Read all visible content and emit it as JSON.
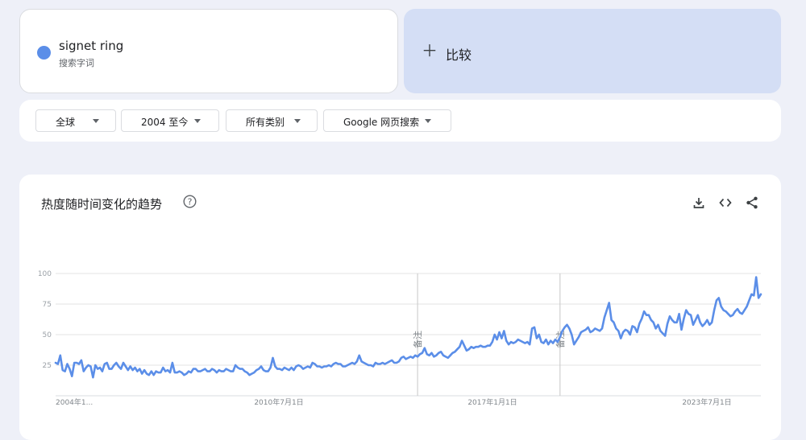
{
  "search_term": {
    "name": "signet ring",
    "type": "搜索字词",
    "color": "#5b8ee8"
  },
  "compare": {
    "label": "比较"
  },
  "filters": [
    {
      "label": "全球"
    },
    {
      "label": "2004 至今"
    },
    {
      "label": "所有类别"
    },
    {
      "label": "Google 网页搜索"
    }
  ],
  "chart": {
    "title": "热度随时间变化的趋势"
  },
  "chart_data": {
    "type": "line",
    "title": "热度随时间变化的趋势",
    "ylim": [
      0,
      100
    ],
    "y_ticks": [
      100,
      75,
      50,
      25
    ],
    "x_tick_labels": [
      "2004年1...",
      "2010年7月1日",
      "2017年1月1日",
      "2023年7月1日"
    ],
    "annotations": [
      {
        "label": "备注",
        "date": "2016-12"
      },
      {
        "label": "备注",
        "date": "2022-01"
      }
    ],
    "series": [
      {
        "color": "#5b8ee8",
        "start": "2004-01",
        "frequency": "monthly",
        "values": [
          27,
          26,
          33,
          21,
          20,
          26,
          22,
          16,
          27,
          27,
          26,
          29,
          20,
          23,
          25,
          24,
          15,
          25,
          22,
          23,
          20,
          26,
          27,
          22,
          22,
          25,
          27,
          24,
          22,
          27,
          24,
          21,
          24,
          21,
          23,
          20,
          22,
          18,
          21,
          18,
          17,
          20,
          17,
          20,
          19,
          19,
          23,
          20,
          21,
          19,
          27,
          19,
          19,
          20,
          19,
          17,
          18,
          20,
          19,
          22,
          22,
          20,
          20,
          21,
          22,
          20,
          20,
          22,
          21,
          19,
          21,
          20,
          20,
          22,
          21,
          20,
          20,
          25,
          23,
          22,
          22,
          20,
          19,
          17,
          18,
          19,
          21,
          22,
          24,
          21,
          20,
          20,
          23,
          31,
          24,
          22,
          22,
          21,
          23,
          22,
          21,
          23,
          21,
          24,
          25,
          24,
          22,
          23,
          24,
          23,
          27,
          26,
          24,
          24,
          23,
          24,
          24,
          25,
          24,
          26,
          27,
          26,
          26,
          24,
          24,
          25,
          26,
          27,
          26,
          28,
          33,
          28,
          27,
          26,
          25,
          25,
          24,
          27,
          26,
          26,
          27,
          26,
          27,
          28,
          29,
          27,
          27,
          28,
          31,
          32,
          30,
          31,
          32,
          31,
          33,
          32,
          34,
          35,
          39,
          34,
          33,
          35,
          32,
          33,
          35,
          36,
          33,
          32,
          31,
          33,
          35,
          36,
          38,
          40,
          45,
          41,
          37,
          38,
          40,
          39,
          40,
          40,
          41,
          40,
          40,
          41,
          41,
          44,
          50,
          46,
          52,
          47,
          53,
          45,
          42,
          44,
          43,
          44,
          46,
          45,
          44,
          43,
          44,
          42,
          55,
          56,
          47,
          50,
          44,
          43,
          46,
          42,
          45,
          43,
          46,
          44,
          48,
          53,
          56,
          58,
          55,
          50,
          42,
          45,
          48,
          52,
          53,
          54,
          56,
          52,
          53,
          55,
          54,
          53,
          55,
          64,
          70,
          76,
          62,
          60,
          55,
          53,
          47,
          52,
          54,
          53,
          50,
          57,
          56,
          52,
          59,
          63,
          69,
          66,
          66,
          62,
          60,
          55,
          58,
          53,
          51,
          49,
          59,
          65,
          62,
          60,
          60,
          67,
          54,
          63,
          70,
          67,
          66,
          58,
          62,
          66,
          60,
          57,
          59,
          62,
          58,
          60,
          70,
          78,
          80,
          73,
          70,
          69,
          67,
          65,
          66,
          69,
          71,
          68,
          67,
          70,
          73,
          78,
          83,
          82,
          97,
          80,
          83
        ]
      }
    ]
  }
}
